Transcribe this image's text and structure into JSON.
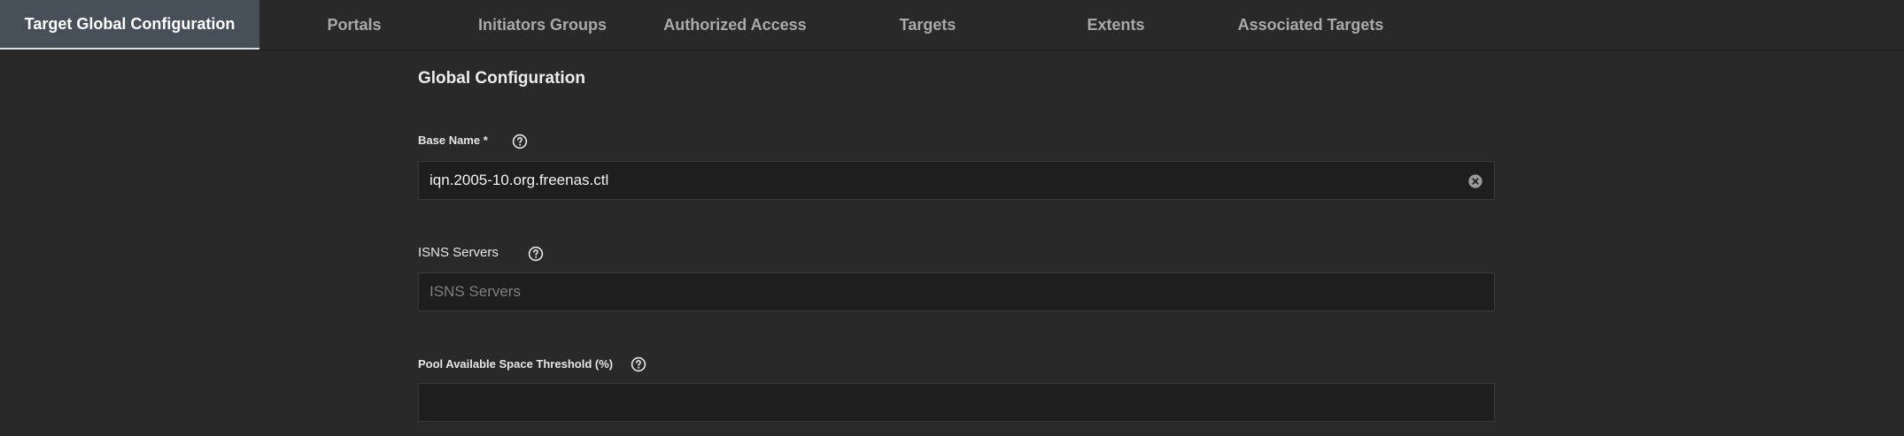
{
  "tabs": [
    {
      "label": "Target Global Configuration",
      "active": true
    },
    {
      "label": "Portals",
      "active": false
    },
    {
      "label": "Initiators Groups",
      "active": false
    },
    {
      "label": "Authorized Access",
      "active": false
    },
    {
      "label": "Targets",
      "active": false
    },
    {
      "label": "Extents",
      "active": false
    },
    {
      "label": "Associated Targets",
      "active": false
    }
  ],
  "form": {
    "title": "Global Configuration",
    "base_name": {
      "label": "Base Name *",
      "value": "iqn.2005-10.org.freenas.ctl",
      "help_icon": "question-circle-icon",
      "clear_icon": "clear-circle-icon"
    },
    "isns_servers": {
      "label": "ISNS Servers",
      "value": "",
      "placeholder": "ISNS Servers",
      "help_icon": "question-circle-icon"
    },
    "pool_threshold": {
      "label": "Pool Available Space Threshold (%)",
      "value": "",
      "placeholder": "",
      "help_icon": "question-circle-icon"
    }
  },
  "colors": {
    "background": "#292929",
    "active_tab": "#475059",
    "input_background": "#1e1e1e",
    "text": "#e8e8e8",
    "inactive_tab_text": "#a9a9a9"
  }
}
